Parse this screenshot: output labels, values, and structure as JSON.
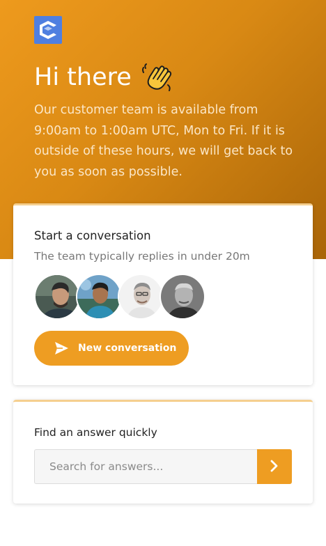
{
  "header": {
    "logo_icon": "chat-logo-icon",
    "greeting": "Hi there",
    "wave_icon": "waving-hand-icon",
    "intro": "Our customer team is available from 9:00am to 1:00am UTC, Mon to Fri. If it is outside of these hours, we will get back to you as soon as possible."
  },
  "conversation": {
    "title": "Start a conversation",
    "subtitle": "The team typically replies in under 20m",
    "avatars": [
      "team-member-1",
      "team-member-2",
      "team-member-3",
      "team-member-4"
    ],
    "button_label": "New conversation",
    "button_icon": "send-icon"
  },
  "search": {
    "title": "Find an answer quickly",
    "placeholder": "Search for answers...",
    "button_icon": "chevron-right-icon"
  },
  "colors": {
    "accent": "#ee9d22",
    "hero_start": "#ee9a1d",
    "hero_end": "#a96508",
    "logo": "#4f7fe0"
  }
}
